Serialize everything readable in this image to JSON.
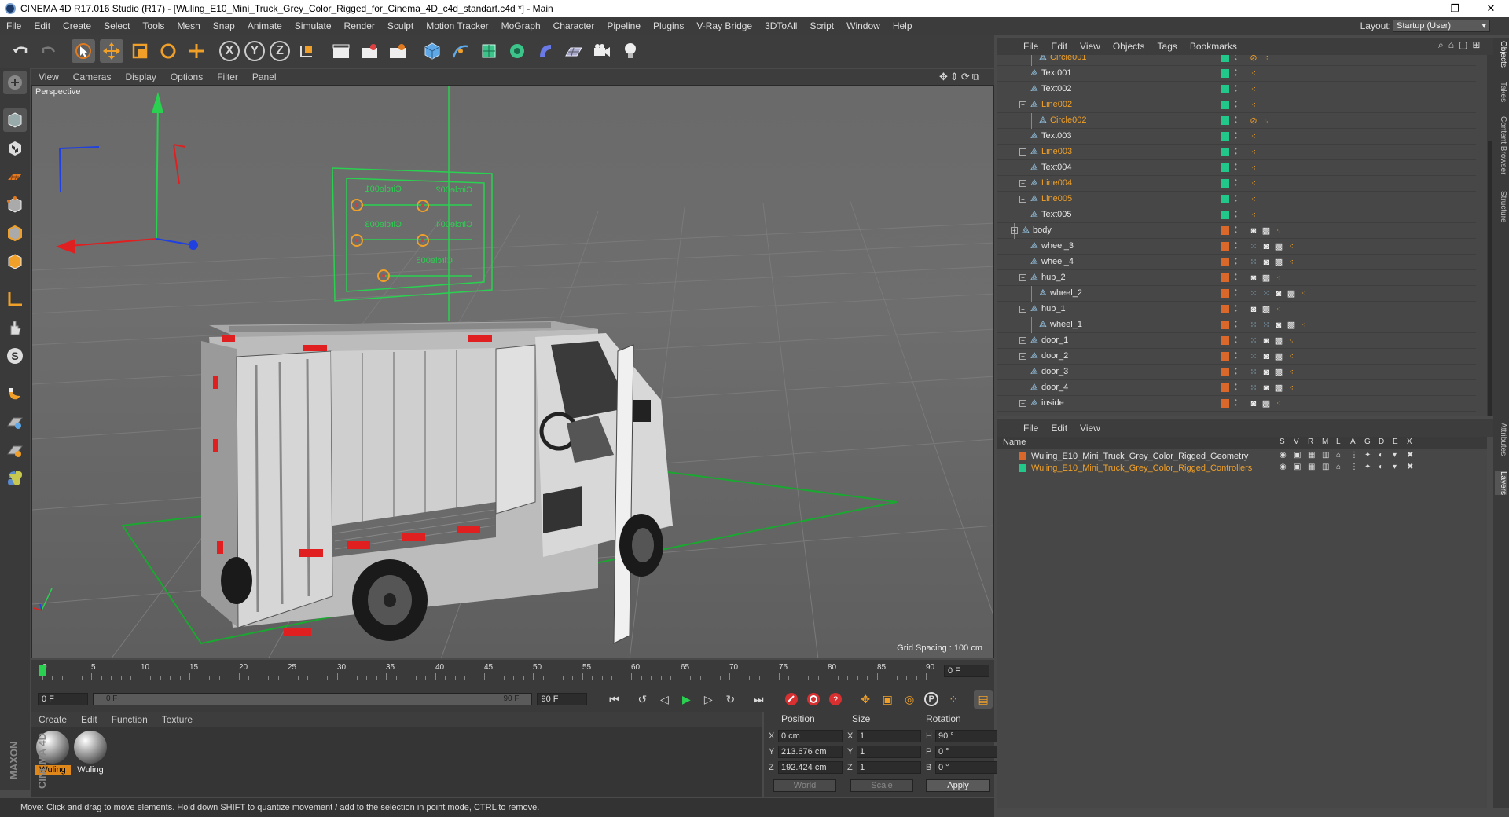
{
  "window": {
    "title": "CINEMA 4D R17.016 Studio (R17) - [Wuling_E10_Mini_Truck_Grey_Color_Rigged_for_Cinema_4D_c4d_standart.c4d *] - Main",
    "min": "—",
    "restore": "❐",
    "close": "✕"
  },
  "menubar": {
    "items": [
      "File",
      "Edit",
      "Create",
      "Select",
      "Tools",
      "Mesh",
      "Snap",
      "Animate",
      "Simulate",
      "Render",
      "Sculpt",
      "Motion Tracker",
      "MoGraph",
      "Character",
      "Pipeline",
      "Plugins",
      "V-Ray Bridge",
      "3DToAll",
      "Script",
      "Window",
      "Help"
    ],
    "layout_label": "Layout:",
    "layout_value": "Startup (User)"
  },
  "toolbar": {
    "x": "X",
    "y": "Y",
    "z": "Z"
  },
  "left_tools": {
    "s_label": "S"
  },
  "viewport": {
    "menu": [
      "View",
      "Cameras",
      "Display",
      "Options",
      "Filter",
      "Panel"
    ],
    "label": "Perspective",
    "grid_spacing": "Grid Spacing : 100 cm",
    "controller_texts": [
      "Circle001",
      "Circle002",
      "Circle003",
      "Circle004",
      "Circle005"
    ]
  },
  "timeline": {
    "ticks": [
      "0",
      "5",
      "10",
      "15",
      "20",
      "25",
      "30",
      "35",
      "40",
      "45",
      "50",
      "55",
      "60",
      "65",
      "70",
      "75",
      "80",
      "85",
      "90"
    ],
    "current_frame": "0 F"
  },
  "transport": {
    "start": "0 F",
    "range_start": "0 F",
    "range_end": "90 F",
    "end": "90 F"
  },
  "material_manager": {
    "menu": [
      "Create",
      "Edit",
      "Function",
      "Texture"
    ],
    "materials": [
      {
        "label": "Wuling",
        "selected": true
      },
      {
        "label": "Wuling",
        "selected": false
      }
    ]
  },
  "coordinates": {
    "headers": {
      "position": "Position",
      "size": "Size",
      "rotation": "Rotation"
    },
    "rows": [
      {
        "axis": "X",
        "pos": "0 cm",
        "size_axis": "X",
        "size": "1",
        "rot_axis": "H",
        "rot": "90 °"
      },
      {
        "axis": "Y",
        "pos": "213.676 cm",
        "size_axis": "Y",
        "size": "1",
        "rot_axis": "P",
        "rot": "0 °"
      },
      {
        "axis": "Z",
        "pos": "192.424 cm",
        "size_axis": "Z",
        "size": "1",
        "rot_axis": "B",
        "rot": "0 °"
      }
    ],
    "world": "World",
    "scale": "Scale",
    "apply": "Apply"
  },
  "status": {
    "text": "Move: Click and drag to move elements. Hold down SHIFT to quantize movement / add to the selection in point mode, CTRL to remove."
  },
  "maxon_logo": "MAXON CINEMA 4D",
  "object_manager": {
    "menu": [
      "File",
      "Edit",
      "View",
      "Objects",
      "Tags",
      "Bookmarks"
    ],
    "rows": [
      {
        "name": "Circle001",
        "depth": 2,
        "orange": true,
        "expand": false,
        "layer": "#21c88a",
        "tags": "circle"
      },
      {
        "name": "Text001",
        "depth": 1,
        "orange": false,
        "expand": false,
        "layer": "#21c88a",
        "tags": "dots"
      },
      {
        "name": "Text002",
        "depth": 1,
        "orange": false,
        "expand": false,
        "layer": "#21c88a",
        "tags": "dots"
      },
      {
        "name": "Line002",
        "depth": 1,
        "orange": true,
        "expand": true,
        "layer": "#21c88a",
        "tags": "dots"
      },
      {
        "name": "Circle002",
        "depth": 2,
        "orange": true,
        "expand": false,
        "layer": "#21c88a",
        "tags": "circle"
      },
      {
        "name": "Text003",
        "depth": 1,
        "orange": false,
        "expand": false,
        "layer": "#21c88a",
        "tags": "dots"
      },
      {
        "name": "Line003",
        "depth": 1,
        "orange": true,
        "expand": true,
        "layer": "#21c88a",
        "tags": "dots"
      },
      {
        "name": "Text004",
        "depth": 1,
        "orange": false,
        "expand": false,
        "layer": "#21c88a",
        "tags": "dots"
      },
      {
        "name": "Line004",
        "depth": 1,
        "orange": true,
        "expand": true,
        "layer": "#21c88a",
        "tags": "dots"
      },
      {
        "name": "Line005",
        "depth": 1,
        "orange": true,
        "expand": true,
        "layer": "#21c88a",
        "tags": "dots"
      },
      {
        "name": "Text005",
        "depth": 1,
        "orange": false,
        "expand": false,
        "layer": "#21c88a",
        "tags": "dots"
      },
      {
        "name": "body",
        "depth": 0,
        "orange": false,
        "expand": true,
        "layer": "#d9682a",
        "tags": "phong"
      },
      {
        "name": "wheel_3",
        "depth": 1,
        "orange": false,
        "expand": false,
        "layer": "#d9682a",
        "tags": "phong-pre"
      },
      {
        "name": "wheel_4",
        "depth": 1,
        "orange": false,
        "expand": false,
        "layer": "#d9682a",
        "tags": "phong-pre"
      },
      {
        "name": "hub_2",
        "depth": 1,
        "orange": false,
        "expand": true,
        "layer": "#d9682a",
        "tags": "phong"
      },
      {
        "name": "wheel_2",
        "depth": 2,
        "orange": false,
        "expand": false,
        "layer": "#d9682a",
        "tags": "phong-pre2"
      },
      {
        "name": "hub_1",
        "depth": 1,
        "orange": false,
        "expand": true,
        "layer": "#d9682a",
        "tags": "phong"
      },
      {
        "name": "wheel_1",
        "depth": 2,
        "orange": false,
        "expand": false,
        "layer": "#d9682a",
        "tags": "phong-pre2"
      },
      {
        "name": "door_1",
        "depth": 1,
        "orange": false,
        "expand": true,
        "layer": "#d9682a",
        "tags": "phong-pre"
      },
      {
        "name": "door_2",
        "depth": 1,
        "orange": false,
        "expand": true,
        "layer": "#d9682a",
        "tags": "phong-pre"
      },
      {
        "name": "door_3",
        "depth": 1,
        "orange": false,
        "expand": false,
        "layer": "#d9682a",
        "tags": "phong-pre"
      },
      {
        "name": "door_4",
        "depth": 1,
        "orange": false,
        "expand": false,
        "layer": "#d9682a",
        "tags": "phong-pre"
      },
      {
        "name": "inside",
        "depth": 1,
        "orange": false,
        "expand": true,
        "layer": "#d9682a",
        "tags": "phong"
      }
    ]
  },
  "side_tabs": [
    "Objects",
    "Takes",
    "Content Browser",
    "Structure",
    "Attributes",
    "Layers"
  ],
  "layer_manager": {
    "menu": [
      "File",
      "Edit",
      "View"
    ],
    "header_name": "Name",
    "columns": [
      "S",
      "V",
      "R",
      "M",
      "L",
      "A",
      "G",
      "D",
      "E",
      "X"
    ],
    "layers": [
      {
        "name": "Wuling_E10_Mini_Truck_Grey_Color_Rigged_Geometry",
        "color": "#d9682a",
        "name_color": "#e6e6e6"
      },
      {
        "name": "Wuling_E10_Mini_Truck_Grey_Color_Rigged_Controllers",
        "color": "#21c88a",
        "name_color": "#f0a028"
      }
    ]
  },
  "colors": {
    "accent_orange": "#f0a028",
    "selection_orange": "#e0871a",
    "green_layer": "#21c88a",
    "orange_layer": "#d9682a"
  }
}
